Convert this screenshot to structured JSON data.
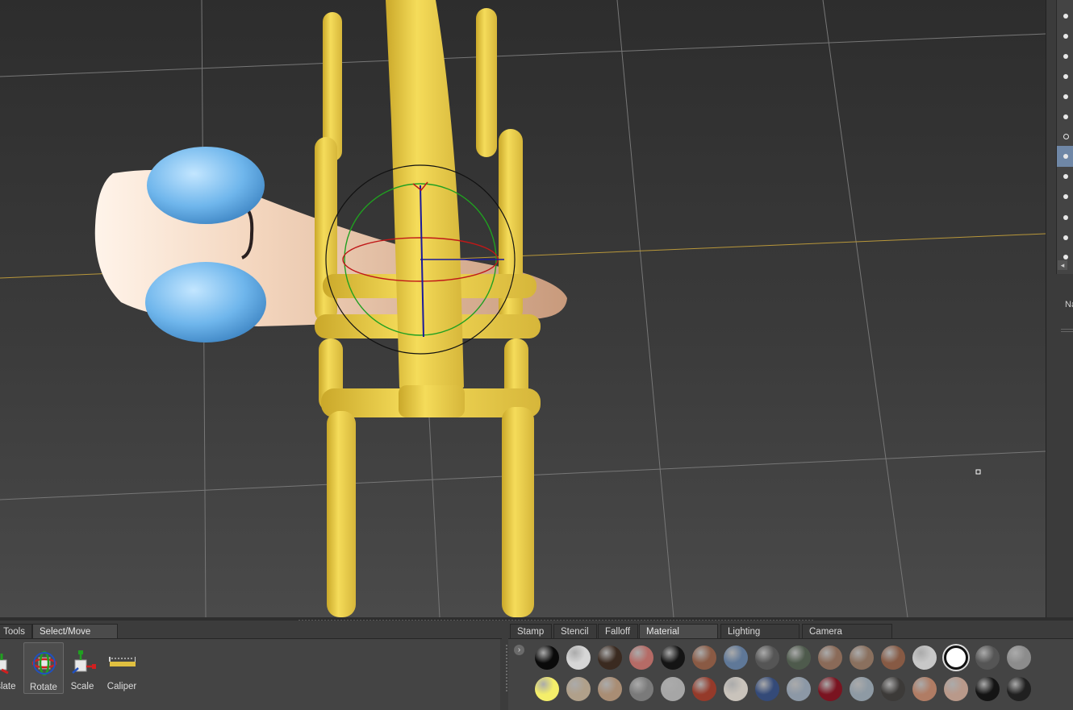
{
  "tool_tabs": [
    {
      "label": "Tools",
      "active": false
    },
    {
      "label": "Select/Move Tools",
      "active": true
    }
  ],
  "tools": [
    {
      "label": "Translate",
      "icon": "translate-icon",
      "active": false
    },
    {
      "label": "Rotate",
      "icon": "rotate-icon",
      "active": true
    },
    {
      "label": "Scale",
      "icon": "scale-icon",
      "active": false
    },
    {
      "label": "Caliper",
      "icon": "caliper-icon",
      "active": false
    }
  ],
  "panel_tabs": [
    {
      "label": "Stamp",
      "active": false
    },
    {
      "label": "Stencil",
      "active": false
    },
    {
      "label": "Falloff",
      "active": false
    },
    {
      "label": "Material Presets",
      "active": true
    },
    {
      "label": "Lighting Presets",
      "active": false
    },
    {
      "label": "Camera Bookmarks",
      "active": false
    }
  ],
  "right_panel": {
    "partial_label": "Na"
  },
  "materials_row1": [
    "#0a0a0a",
    "#d6d6d6",
    "#3a2a20",
    "#b56b66",
    "#141414",
    "#8a5a44",
    "#5f7898",
    "#555555",
    "#4e5a4c",
    "#8a6a58",
    "#8a705e",
    "#875a44",
    "#c8c8c8",
    "#ffffff",
    "#555555",
    "#8c8c8c"
  ],
  "materials_row2": [
    "#f4ee6a",
    "#b0a08a",
    "#a98d74",
    "#7a7a7a",
    "#a6a6a6",
    "#953a2a",
    "#c9c3bb",
    "#344a78",
    "#8c98a6",
    "#7a1420",
    "#8e9aa4",
    "#3c3a38",
    "#b07c64",
    "#b9998a",
    "#141414",
    "#202020"
  ],
  "colors": {
    "model_yellow": "#f0d24a",
    "skin": "#e3b699",
    "blue": "#6fb4e6",
    "accent_selected": "#6f87a6"
  }
}
